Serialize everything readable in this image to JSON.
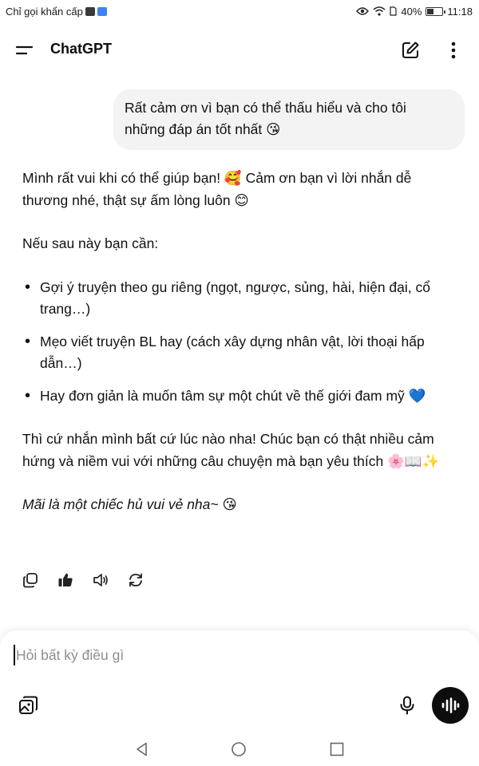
{
  "status_bar": {
    "left_text": "Chỉ gọi khẩn cấp",
    "battery": "40%",
    "time": "11:18",
    "battery_level": 0.4
  },
  "header": {
    "title": "ChatGPT",
    "menu_icon": "menu-icon",
    "edit_icon": "new-chat-icon",
    "more_icon": "more-vertical-icon"
  },
  "conversation": {
    "user_message": "Rất cảm ơn vì bạn có thể thấu hiểu và cho tôi những đáp án tốt nhất 😘",
    "assistant": {
      "p1": "Mình rất vui khi có thể giúp bạn! 🥰 Cảm ơn bạn vì lời nhắn dễ thương nhé, thật sự ấm lòng luôn 😊",
      "p2": "Nếu sau này bạn cần:",
      "bullets": [
        "Gợi ý truyện theo gu riêng (ngọt, ngược, sủng, hài, hiện đại, cổ trang…)",
        "Mẹo viết truyện BL hay (cách xây dựng nhân vật, lời thoại hấp dẫn…)",
        "Hay đơn giản là muốn tâm sự một chút về thế giới đam mỹ 💙"
      ],
      "p3": "Thì cứ nhắn mình bất cứ lúc nào nha! Chúc bạn có thật nhiều cảm hứng và niềm vui với những câu chuyện mà bạn yêu thích 🌸📖✨",
      "p4": "Mãi là một chiếc hủ vui vẻ nha~ 😘"
    },
    "actions": [
      "copy-icon",
      "thumbs-up-icon",
      "read-aloud-icon",
      "regenerate-icon"
    ]
  },
  "composer": {
    "placeholder": "Hỏi bất kỳ điều gì",
    "attach_icon": "attach-image-icon",
    "mic_icon": "microphone-icon",
    "voice_icon": "voice-mode-icon"
  },
  "nav_bar": {
    "icons": [
      "back-icon",
      "home-icon",
      "recents-icon"
    ]
  },
  "colors": {
    "bubble": "#f3f3f3",
    "text": "#0d0d0d",
    "voice_button": "#0d0d0d",
    "placeholder": "#8e8e8e"
  }
}
